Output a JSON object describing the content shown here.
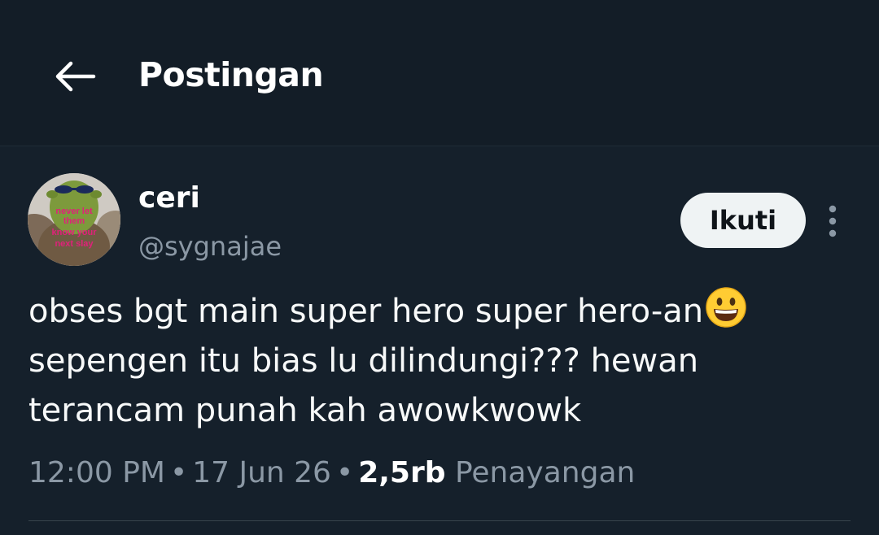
{
  "header": {
    "title": "Postingan",
    "back_icon": "arrow-left-icon"
  },
  "author": {
    "display_name": "ceri",
    "handle": "@sygnajae",
    "avatar_caption_lines": [
      "never let",
      "them",
      "know your",
      "next slay"
    ]
  },
  "actions": {
    "follow_label": "Ikuti",
    "more_icon": "more-vertical-icon"
  },
  "tweet": {
    "line1": "obses bgt main super hero super hero-an",
    "emoji": "grinning-face-emoji",
    "line2": "sepengen itu bias lu dilindungi??? hewan",
    "line3": "terancam punah kah awowkwowk"
  },
  "meta": {
    "time": "12:00 PM",
    "date": "17 Jun 26",
    "views_count": "2,5rb",
    "views_label": "Penayangan",
    "separator": "•"
  },
  "colors": {
    "background": "#15202b",
    "text_primary": "#ffffff",
    "text_secondary": "#8b98a5",
    "follow_button_bg": "#eff3f4"
  }
}
